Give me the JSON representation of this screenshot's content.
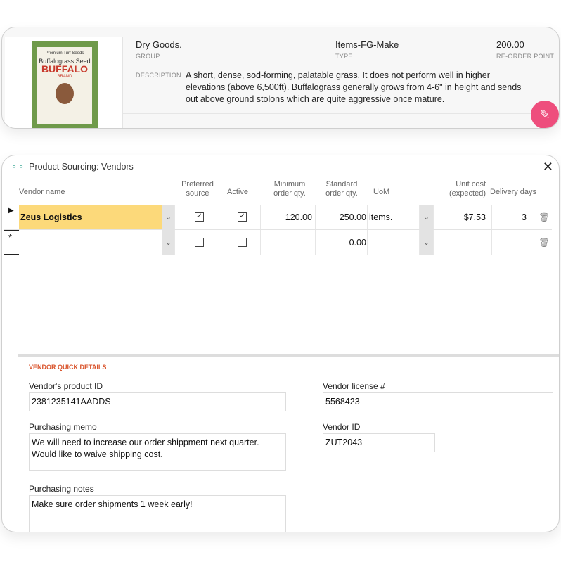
{
  "product": {
    "image_text": [
      "Premium Turf Seeds",
      "Buffalograss Seed",
      "BUFFALO",
      "BRAND"
    ],
    "group": {
      "value": "Dry Goods.",
      "label": "GROUP"
    },
    "type": {
      "value": "Items-FG-Make",
      "label": "TYPE"
    },
    "reorder": {
      "value": "200.00",
      "label": "RE-ORDER POINT"
    },
    "description_label": "DESCRIPTION",
    "description": "A short, dense, sod-forming, palatable grass. It does not perform well in higher elevations (above 6,500ft). Buffalograss generally grows from 4-6\" in height and sends out above ground stolons which are quite aggressive once mature."
  },
  "dialog": {
    "title": "Product Sourcing: Vendors",
    "close": "✕",
    "columns": {
      "vendor": "Vendor name",
      "preferred": "Preferred source",
      "active": "Active",
      "min": "Minimum order qty.",
      "std": "Standard order qty.",
      "uom": "UoM",
      "cost": "Unit cost (expected)",
      "days": "Delivery days"
    },
    "rows": [
      {
        "marker": "▶",
        "vendor": "Zeus Logistics",
        "preferred": true,
        "active": true,
        "min": "120.00",
        "std": "250.00",
        "uom": "items.",
        "cost": "$7.53",
        "days": "3"
      },
      {
        "marker": "*",
        "vendor": "",
        "preferred": false,
        "active": false,
        "min": "",
        "std": "0.00",
        "uom": "",
        "cost": "",
        "days": ""
      }
    ],
    "quick": {
      "title": "VENDOR QUICK DETAILS",
      "product_id_label": "Vendor's product ID",
      "product_id": "2381235141AADDS",
      "license_label": "Vendor license #",
      "license": "5568423",
      "memo_label": "Purchasing memo",
      "memo": "We will need to increase our order shippment next quarter.  Would like to waive shipping cost.",
      "vendor_id_label": "Vendor ID",
      "vendor_id": "ZUT2043",
      "notes_label": "Purchasing notes",
      "notes": "Make sure order shipments 1 week early!"
    }
  },
  "colors": {
    "accent": "#ee4e7d",
    "selected_row": "#fcd97a",
    "section": "#d9532b"
  }
}
